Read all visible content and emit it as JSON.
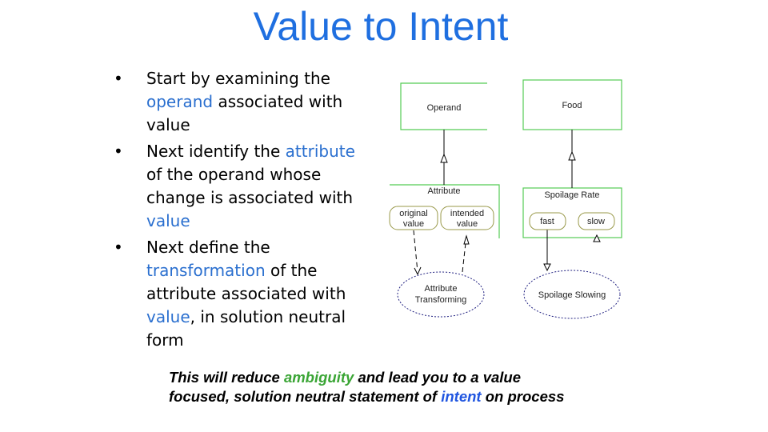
{
  "title": "Value to Intent",
  "bullets": [
    {
      "parts": [
        "Start by examining the ",
        "operand",
        " associated with value"
      ]
    },
    {
      "parts": [
        "Next identify the ",
        "attribute",
        " of the operand whose change is associated with ",
        "value"
      ]
    },
    {
      "parts": [
        "Next define the ",
        "transformation",
        " of the attribute associated with ",
        "value",
        ", in solution neutral form"
      ]
    }
  ],
  "bullet_symbol": "•",
  "diagram": {
    "operand": "Operand",
    "food": "Food",
    "attribute": "Attribute",
    "original_value": [
      "original",
      "value"
    ],
    "intended_value": [
      "intended",
      "value"
    ],
    "attribute_transforming": [
      "Attribute",
      "Transforming"
    ],
    "spoilage_rate": "Spoilage Rate",
    "fast": "fast",
    "slow": "slow",
    "spoilage_slowing": "Spoilage Slowing"
  },
  "conclusion": {
    "parts": [
      "This will reduce ",
      "ambiguity",
      " and lead you to a value",
      "focused, solution neutral statement of ",
      "intent",
      " on process"
    ]
  },
  "colors": {
    "title": "#1f6fe0",
    "highlight": "#2a6fcf",
    "ambiguity": "#3aa535",
    "intent": "#1f55e0",
    "box_border": "#55cc55",
    "ellipse": "#202080"
  }
}
